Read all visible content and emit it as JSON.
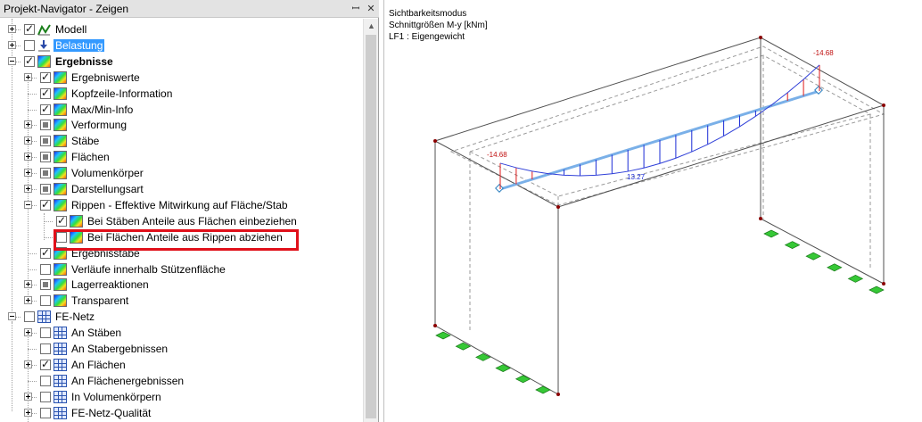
{
  "navigator": {
    "title": "Projekt-Navigator - Zeigen",
    "pin_glyph": "ꟷ",
    "close_glyph": "✕",
    "items": [
      {
        "label": "Modell",
        "expander": "plus",
        "check": "checked",
        "icon": "model",
        "bold": false,
        "selected": false
      },
      {
        "label": "Belastung",
        "expander": "plus",
        "check": "unchecked",
        "icon": "load",
        "bold": false,
        "selected": true
      },
      {
        "label": "Ergebnisse",
        "expander": "minus",
        "check": "checked",
        "icon": "result",
        "bold": true,
        "selected": false
      },
      {
        "label": "Ergebniswerte",
        "expander": "plus",
        "check": "checked",
        "icon": "result"
      },
      {
        "label": "Kopfzeile-Information",
        "expander": "",
        "check": "checked",
        "icon": "result"
      },
      {
        "label": "Max/Min-Info",
        "expander": "",
        "check": "checked",
        "icon": "result"
      },
      {
        "label": "Verformung",
        "expander": "plus",
        "check": "partial",
        "icon": "result"
      },
      {
        "label": "Stäbe",
        "expander": "plus",
        "check": "partial",
        "icon": "result"
      },
      {
        "label": "Flächen",
        "expander": "plus",
        "check": "partial",
        "icon": "result"
      },
      {
        "label": "Volumenkörper",
        "expander": "plus",
        "check": "partial",
        "icon": "result"
      },
      {
        "label": "Darstellungsart",
        "expander": "plus",
        "check": "partial",
        "icon": "result"
      },
      {
        "label": "Rippen - Effektive Mitwirkung auf Fläche/Stab",
        "expander": "minus",
        "check": "checked",
        "icon": "result"
      },
      {
        "label": "Bei Stäben Anteile aus Flächen einbeziehen",
        "expander": "",
        "check": "checked",
        "icon": "result"
      },
      {
        "label": "Bei Flächen Anteile aus Rippen abziehen",
        "expander": "",
        "check": "unchecked",
        "icon": "result"
      },
      {
        "label": "Ergebnisstäbe",
        "expander": "",
        "check": "checked",
        "icon": "result"
      },
      {
        "label": "Verläufe innerhalb Stützenfläche",
        "expander": "",
        "check": "unchecked",
        "icon": "result"
      },
      {
        "label": "Lagerreaktionen",
        "expander": "plus",
        "check": "partial",
        "icon": "result"
      },
      {
        "label": "Transparent",
        "expander": "plus",
        "check": "unchecked",
        "icon": "result"
      },
      {
        "label": "FE-Netz",
        "expander": "minus",
        "check": "unchecked",
        "icon": "mesh"
      },
      {
        "label": "An Stäben",
        "expander": "plus",
        "check": "unchecked",
        "icon": "mesh"
      },
      {
        "label": "An Stabergebnissen",
        "expander": "",
        "check": "unchecked",
        "icon": "mesh"
      },
      {
        "label": "An Flächen",
        "expander": "plus",
        "check": "checked",
        "icon": "mesh"
      },
      {
        "label": "An Flächenergebnissen",
        "expander": "",
        "check": "unchecked",
        "icon": "mesh"
      },
      {
        "label": "In Volumenkörpern",
        "expander": "plus",
        "check": "unchecked",
        "icon": "mesh"
      },
      {
        "label": "FE-Netz-Qualität",
        "expander": "plus",
        "check": "unchecked",
        "icon": "mesh"
      }
    ]
  },
  "viewport": {
    "info_lines": [
      "Sichtbarkeitsmodus",
      "Schnittgrößen M-y [kNm]",
      "LF1 : Eigengewicht"
    ],
    "labels": {
      "left_end": "-14.68",
      "right_end": "-14.68",
      "midspan": "13.27"
    }
  },
  "colors": {
    "selection": "#3399ff",
    "highlight": "#e0101a",
    "moment_positive": "#1a2bd6",
    "moment_negative": "#e01a1a",
    "support": "#36c836"
  }
}
